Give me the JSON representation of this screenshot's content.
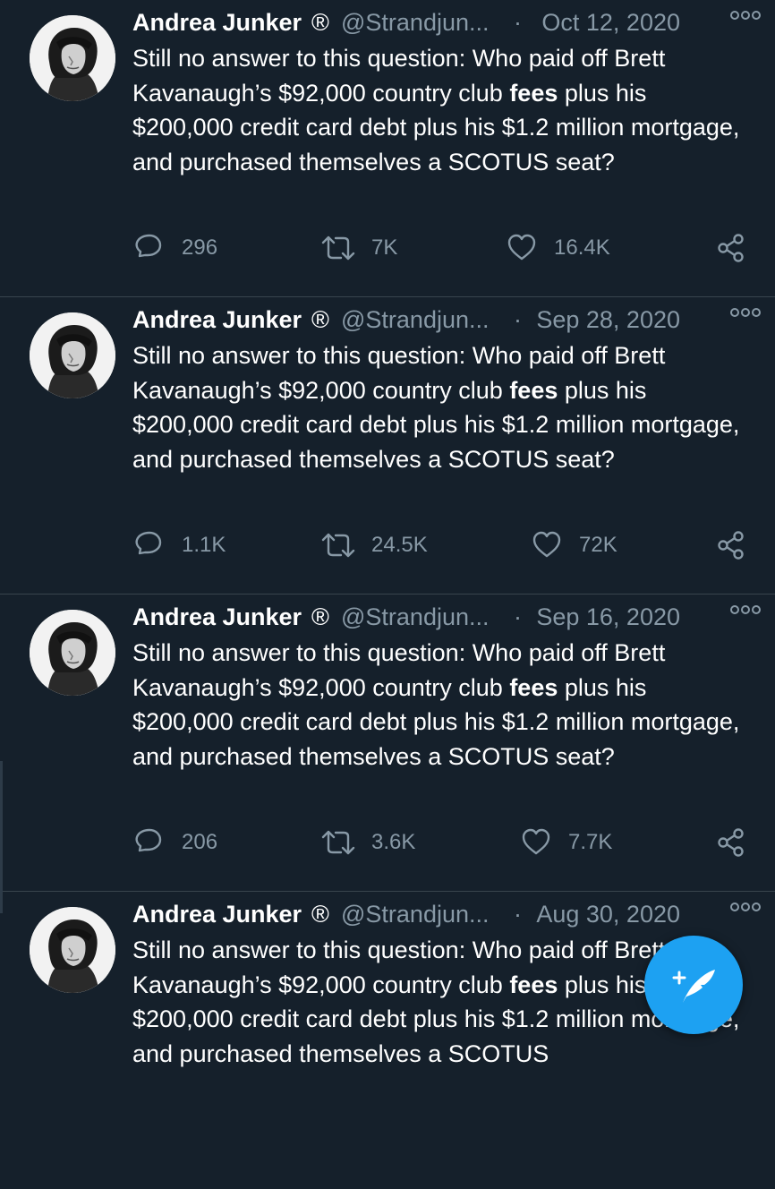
{
  "tweets": [
    {
      "author": "Andrea Junker",
      "registered_mark": "®",
      "handle": "@Strandjun...",
      "separator": "·",
      "date": "Oct 12, 2020",
      "text_before": "Still no answer to this question: Who paid off Brett Kavanaugh’s $92,000 country club ",
      "text_bold": "fees",
      "text_after": " plus his $200,000 credit card debt plus his $1.2 million mortgage, and purchased themselves a SCOTUS seat?",
      "replies": "296",
      "retweets": "7K",
      "likes": "16.4K"
    },
    {
      "author": "Andrea Junker",
      "registered_mark": "®",
      "handle": "@Strandjun...",
      "separator": "·",
      "date": "Sep 28, 2020",
      "text_before": "Still no answer to this question: Who paid off Brett Kavanaugh’s $92,000 country club ",
      "text_bold": "fees",
      "text_after": " plus his $200,000 credit card debt plus his $1.2 million mortgage, and purchased themselves a SCOTUS seat?",
      "replies": "1.1K",
      "retweets": "24.5K",
      "likes": "72K"
    },
    {
      "author": "Andrea Junker",
      "registered_mark": "®",
      "handle": "@Strandjun...",
      "separator": "·",
      "date": "Sep 16, 2020",
      "text_before": "Still no answer to this question: Who paid off Brett Kavanaugh’s $92,000 country club ",
      "text_bold": "fees",
      "text_after": " plus his $200,000 credit card debt plus his $1.2 million mortgage, and purchased themselves a SCOTUS seat?",
      "replies": "206",
      "retweets": "3.6K",
      "likes": "7.7K"
    },
    {
      "author": "Andrea Junker",
      "registered_mark": "®",
      "handle": "@Strandjun...",
      "separator": "·",
      "date": "Aug 30, 2020",
      "text_before": "Still no answer to this question: Who paid off Brett Kavanaugh’s $92,000 country club ",
      "text_bold": "fees",
      "text_after": " plus his $200,000 credit card debt plus his $1.2 million mortgage, and purchased themselves a SCOTUS",
      "replies": "",
      "retweets": "",
      "likes": ""
    }
  ],
  "icons": {
    "avatar": "avatar-photo",
    "more": "more-options-icon",
    "reply": "reply-icon",
    "retweet": "retweet-icon",
    "like": "heart-icon",
    "share": "share-icon",
    "compose": "compose-tweet-icon"
  },
  "colors": {
    "background": "#15202b",
    "text": "#ffffff",
    "secondary": "#8899a6",
    "divider": "#38444d",
    "accent": "#1da1f2"
  }
}
